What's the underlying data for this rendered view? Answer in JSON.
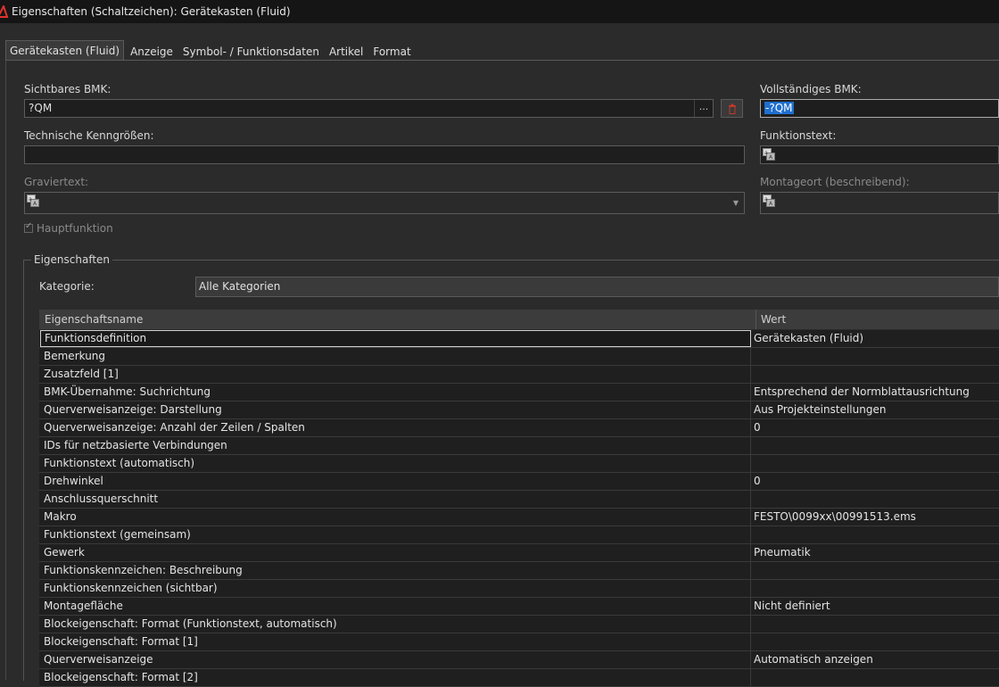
{
  "window": {
    "title": "Eigenschaften (Schaltzeichen): Gerätekasten (Fluid)"
  },
  "tabs": [
    {
      "label": "Gerätekasten (Fluid)",
      "active": true
    },
    {
      "label": "Anzeige"
    },
    {
      "label": "Symbol- / Funktionsdaten"
    },
    {
      "label": "Artikel"
    },
    {
      "label": "Format"
    }
  ],
  "form": {
    "sichtbares_bmk_label": "Sichtbares BMK:",
    "sichtbares_bmk_value": "?QM",
    "ellipsis_label": "...",
    "vollstaendiges_bmk_label": "Vollständiges BMK:",
    "vollstaendiges_bmk_value": "-?QM",
    "technische_label": "Technische Kenngrößen:",
    "technische_value": "",
    "funktionstext_label": "Funktionstext:",
    "graviertext_label": "Graviertext:",
    "montageort_label": "Montageort (beschreibend):",
    "hauptfunktion_label": "Hauptfunktion"
  },
  "eigenschaften": {
    "group_title": "Eigenschaften",
    "kategorie_label": "Kategorie:",
    "kategorie_value": "Alle Kategorien",
    "columns": {
      "name": "Eigenschaftsname",
      "value": "Wert"
    },
    "rows": [
      {
        "name": "Funktionsdefinition",
        "value": "Gerätekasten (Fluid)"
      },
      {
        "name": "Bemerkung",
        "value": ""
      },
      {
        "name": "Zusatzfeld [1]",
        "value": ""
      },
      {
        "name": "BMK-Übernahme: Suchrichtung",
        "value": "Entsprechend der Normblattausrichtung"
      },
      {
        "name": "Querverweisanzeige: Darstellung",
        "value": "Aus Projekteinstellungen"
      },
      {
        "name": "Querverweisanzeige: Anzahl der Zeilen / Spalten",
        "value": "0"
      },
      {
        "name": "IDs für netzbasierte Verbindungen",
        "value": ""
      },
      {
        "name": "Funktionstext (automatisch)",
        "value": ""
      },
      {
        "name": "Drehwinkel",
        "value": "0"
      },
      {
        "name": "Anschlussquerschnitt",
        "value": ""
      },
      {
        "name": "Makro",
        "value": "FESTO\\0099xx\\00991513.ems"
      },
      {
        "name": "Funktionstext (gemeinsam)",
        "value": ""
      },
      {
        "name": "Gewerk",
        "value": "Pneumatik"
      },
      {
        "name": "Funktionskennzeichen: Beschreibung",
        "value": ""
      },
      {
        "name": "Funktionskennzeichen (sichtbar)",
        "value": ""
      },
      {
        "name": "Montagefläche",
        "value": "Nicht definiert"
      },
      {
        "name": "Blockeigenschaft: Format (Funktionstext, automatisch)",
        "value": ""
      },
      {
        "name": "Blockeigenschaft: Format [1]",
        "value": ""
      },
      {
        "name": "Querverweisanzeige",
        "value": "Automatisch anzeigen"
      },
      {
        "name": "Blockeigenschaft: Format [2]",
        "value": ""
      }
    ]
  },
  "colors": {
    "accent_selection": "#1f6fd0",
    "app_icon": "#e0332d",
    "trash": "#c0392b"
  },
  "icons": [
    "app-logo-icon",
    "ellipsis-icon",
    "trash-icon",
    "multilanguage-icon",
    "chevron-down-icon",
    "checkbox-checked-icon"
  ]
}
